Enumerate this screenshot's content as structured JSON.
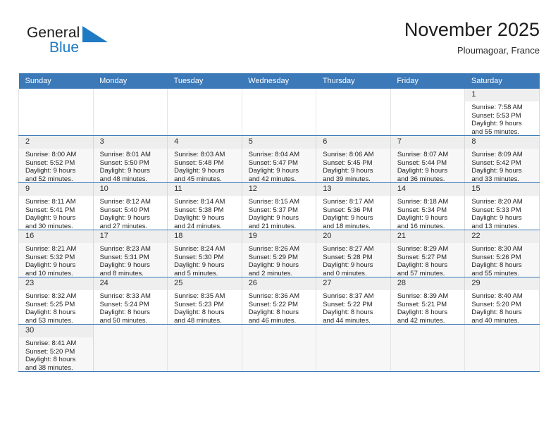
{
  "brand": {
    "name_part1": "General",
    "name_part2": "Blue",
    "accent_color": "#1f7ac4"
  },
  "header": {
    "title": "November 2025",
    "subtitle": "Ploumagoar, France"
  },
  "theme": {
    "header_row_color": "#3b79b9",
    "row_separator_color": "#3b79b9",
    "daynum_band_color": "#efefef",
    "alt_row_color": "#f7f7f7"
  },
  "weekdays": [
    "Sunday",
    "Monday",
    "Tuesday",
    "Wednesday",
    "Thursday",
    "Friday",
    "Saturday"
  ],
  "labels": {
    "sunrise": "Sunrise:",
    "sunset": "Sunset:",
    "daylight": "Daylight:"
  },
  "weeks": [
    [
      {
        "blank": true
      },
      {
        "blank": true
      },
      {
        "blank": true
      },
      {
        "blank": true
      },
      {
        "blank": true
      },
      {
        "blank": true
      },
      {
        "day": "1",
        "sunrise": "Sunrise: 7:58 AM",
        "sunset": "Sunset: 5:53 PM",
        "daylight_l1": "Daylight: 9 hours",
        "daylight_l2": "and 55 minutes."
      }
    ],
    [
      {
        "day": "2",
        "sunrise": "Sunrise: 8:00 AM",
        "sunset": "Sunset: 5:52 PM",
        "daylight_l1": "Daylight: 9 hours",
        "daylight_l2": "and 52 minutes."
      },
      {
        "day": "3",
        "sunrise": "Sunrise: 8:01 AM",
        "sunset": "Sunset: 5:50 PM",
        "daylight_l1": "Daylight: 9 hours",
        "daylight_l2": "and 48 minutes."
      },
      {
        "day": "4",
        "sunrise": "Sunrise: 8:03 AM",
        "sunset": "Sunset: 5:48 PM",
        "daylight_l1": "Daylight: 9 hours",
        "daylight_l2": "and 45 minutes."
      },
      {
        "day": "5",
        "sunrise": "Sunrise: 8:04 AM",
        "sunset": "Sunset: 5:47 PM",
        "daylight_l1": "Daylight: 9 hours",
        "daylight_l2": "and 42 minutes."
      },
      {
        "day": "6",
        "sunrise": "Sunrise: 8:06 AM",
        "sunset": "Sunset: 5:45 PM",
        "daylight_l1": "Daylight: 9 hours",
        "daylight_l2": "and 39 minutes."
      },
      {
        "day": "7",
        "sunrise": "Sunrise: 8:07 AM",
        "sunset": "Sunset: 5:44 PM",
        "daylight_l1": "Daylight: 9 hours",
        "daylight_l2": "and 36 minutes."
      },
      {
        "day": "8",
        "sunrise": "Sunrise: 8:09 AM",
        "sunset": "Sunset: 5:42 PM",
        "daylight_l1": "Daylight: 9 hours",
        "daylight_l2": "and 33 minutes."
      }
    ],
    [
      {
        "day": "9",
        "sunrise": "Sunrise: 8:11 AM",
        "sunset": "Sunset: 5:41 PM",
        "daylight_l1": "Daylight: 9 hours",
        "daylight_l2": "and 30 minutes."
      },
      {
        "day": "10",
        "sunrise": "Sunrise: 8:12 AM",
        "sunset": "Sunset: 5:40 PM",
        "daylight_l1": "Daylight: 9 hours",
        "daylight_l2": "and 27 minutes."
      },
      {
        "day": "11",
        "sunrise": "Sunrise: 8:14 AM",
        "sunset": "Sunset: 5:38 PM",
        "daylight_l1": "Daylight: 9 hours",
        "daylight_l2": "and 24 minutes."
      },
      {
        "day": "12",
        "sunrise": "Sunrise: 8:15 AM",
        "sunset": "Sunset: 5:37 PM",
        "daylight_l1": "Daylight: 9 hours",
        "daylight_l2": "and 21 minutes."
      },
      {
        "day": "13",
        "sunrise": "Sunrise: 8:17 AM",
        "sunset": "Sunset: 5:36 PM",
        "daylight_l1": "Daylight: 9 hours",
        "daylight_l2": "and 18 minutes."
      },
      {
        "day": "14",
        "sunrise": "Sunrise: 8:18 AM",
        "sunset": "Sunset: 5:34 PM",
        "daylight_l1": "Daylight: 9 hours",
        "daylight_l2": "and 16 minutes."
      },
      {
        "day": "15",
        "sunrise": "Sunrise: 8:20 AM",
        "sunset": "Sunset: 5:33 PM",
        "daylight_l1": "Daylight: 9 hours",
        "daylight_l2": "and 13 minutes."
      }
    ],
    [
      {
        "day": "16",
        "sunrise": "Sunrise: 8:21 AM",
        "sunset": "Sunset: 5:32 PM",
        "daylight_l1": "Daylight: 9 hours",
        "daylight_l2": "and 10 minutes."
      },
      {
        "day": "17",
        "sunrise": "Sunrise: 8:23 AM",
        "sunset": "Sunset: 5:31 PM",
        "daylight_l1": "Daylight: 9 hours",
        "daylight_l2": "and 8 minutes."
      },
      {
        "day": "18",
        "sunrise": "Sunrise: 8:24 AM",
        "sunset": "Sunset: 5:30 PM",
        "daylight_l1": "Daylight: 9 hours",
        "daylight_l2": "and 5 minutes."
      },
      {
        "day": "19",
        "sunrise": "Sunrise: 8:26 AM",
        "sunset": "Sunset: 5:29 PM",
        "daylight_l1": "Daylight: 9 hours",
        "daylight_l2": "and 2 minutes."
      },
      {
        "day": "20",
        "sunrise": "Sunrise: 8:27 AM",
        "sunset": "Sunset: 5:28 PM",
        "daylight_l1": "Daylight: 9 hours",
        "daylight_l2": "and 0 minutes."
      },
      {
        "day": "21",
        "sunrise": "Sunrise: 8:29 AM",
        "sunset": "Sunset: 5:27 PM",
        "daylight_l1": "Daylight: 8 hours",
        "daylight_l2": "and 57 minutes."
      },
      {
        "day": "22",
        "sunrise": "Sunrise: 8:30 AM",
        "sunset": "Sunset: 5:26 PM",
        "daylight_l1": "Daylight: 8 hours",
        "daylight_l2": "and 55 minutes."
      }
    ],
    [
      {
        "day": "23",
        "sunrise": "Sunrise: 8:32 AM",
        "sunset": "Sunset: 5:25 PM",
        "daylight_l1": "Daylight: 8 hours",
        "daylight_l2": "and 53 minutes."
      },
      {
        "day": "24",
        "sunrise": "Sunrise: 8:33 AM",
        "sunset": "Sunset: 5:24 PM",
        "daylight_l1": "Daylight: 8 hours",
        "daylight_l2": "and 50 minutes."
      },
      {
        "day": "25",
        "sunrise": "Sunrise: 8:35 AM",
        "sunset": "Sunset: 5:23 PM",
        "daylight_l1": "Daylight: 8 hours",
        "daylight_l2": "and 48 minutes."
      },
      {
        "day": "26",
        "sunrise": "Sunrise: 8:36 AM",
        "sunset": "Sunset: 5:22 PM",
        "daylight_l1": "Daylight: 8 hours",
        "daylight_l2": "and 46 minutes."
      },
      {
        "day": "27",
        "sunrise": "Sunrise: 8:37 AM",
        "sunset": "Sunset: 5:22 PM",
        "daylight_l1": "Daylight: 8 hours",
        "daylight_l2": "and 44 minutes."
      },
      {
        "day": "28",
        "sunrise": "Sunrise: 8:39 AM",
        "sunset": "Sunset: 5:21 PM",
        "daylight_l1": "Daylight: 8 hours",
        "daylight_l2": "and 42 minutes."
      },
      {
        "day": "29",
        "sunrise": "Sunrise: 8:40 AM",
        "sunset": "Sunset: 5:20 PM",
        "daylight_l1": "Daylight: 8 hours",
        "daylight_l2": "and 40 minutes."
      }
    ],
    [
      {
        "day": "30",
        "sunrise": "Sunrise: 8:41 AM",
        "sunset": "Sunset: 5:20 PM",
        "daylight_l1": "Daylight: 8 hours",
        "daylight_l2": "and 38 minutes."
      },
      {
        "blank": true
      },
      {
        "blank": true
      },
      {
        "blank": true
      },
      {
        "blank": true
      },
      {
        "blank": true
      },
      {
        "blank": true
      }
    ]
  ]
}
